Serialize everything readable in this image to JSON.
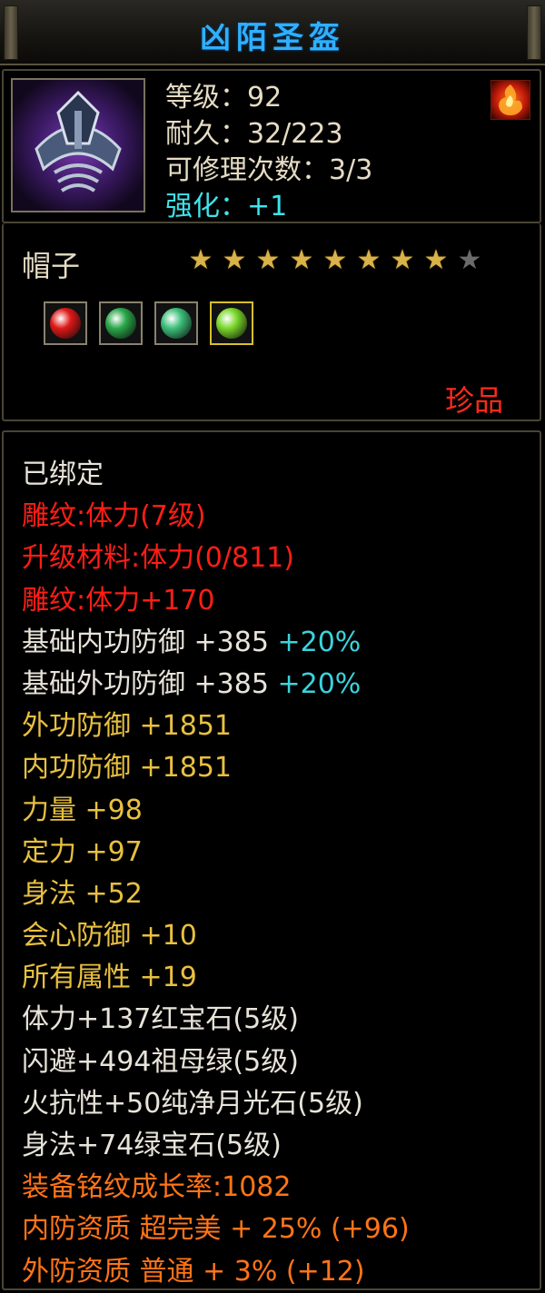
{
  "title": "凶陌圣盔",
  "item": {
    "icon": "crown-helmet-icon",
    "level": "等级：92",
    "durability": "耐久：32/223",
    "repairs": "可修理次数：3/3",
    "enhance": "强化：+1",
    "badge_icon": "fire-emblem-icon"
  },
  "type": {
    "name": "帽子",
    "stars_filled": 8,
    "stars_total": 9
  },
  "gems": [
    {
      "icon": "ruby-gem-icon",
      "color": "#e01818"
    },
    {
      "icon": "jade-ring-gem-icon",
      "color": "#2aa84a"
    },
    {
      "icon": "jade-shard-gem-icon",
      "color": "#3cc07a"
    },
    {
      "icon": "emerald-gem-icon",
      "color": "#7ad82a"
    }
  ],
  "rarity": "珍品",
  "stats": [
    {
      "text": "已绑定",
      "color": "white"
    },
    {
      "text": "雕纹:体力(7级)",
      "color": "red"
    },
    {
      "text": "升级材料:体力(0/811)",
      "color": "red"
    },
    {
      "text": "雕纹:体力+170",
      "color": "red"
    },
    {
      "text": "基础内功防御 +385 ",
      "extra": "+20%",
      "color": "white"
    },
    {
      "text": "基础外功防御 +385 ",
      "extra": "+20%",
      "color": "white"
    },
    {
      "text": "外功防御 +1851",
      "color": "gold"
    },
    {
      "text": "内功防御 +1851",
      "color": "gold"
    },
    {
      "text": "力量 +98",
      "color": "gold"
    },
    {
      "text": "定力 +97",
      "color": "gold"
    },
    {
      "text": "身法 +52",
      "color": "gold"
    },
    {
      "text": "会心防御 +10",
      "color": "gold"
    },
    {
      "text": "所有属性 +19",
      "color": "gold"
    },
    {
      "text": "体力+137红宝石(5级)",
      "color": "white"
    },
    {
      "text": "闪避+494祖母绿(5级)",
      "color": "white"
    },
    {
      "text": "火抗性+50纯净月光石(5级)",
      "color": "white"
    },
    {
      "text": "身法+74绿宝石(5级)",
      "color": "white"
    },
    {
      "text": "装备铭纹成长率:1082",
      "color": "orange"
    },
    {
      "text": "内防资质 超完美 + 25% (+96)",
      "color": "orange"
    },
    {
      "text": "外防资质 普通 + 3% (+12)",
      "color": "orange"
    }
  ]
}
